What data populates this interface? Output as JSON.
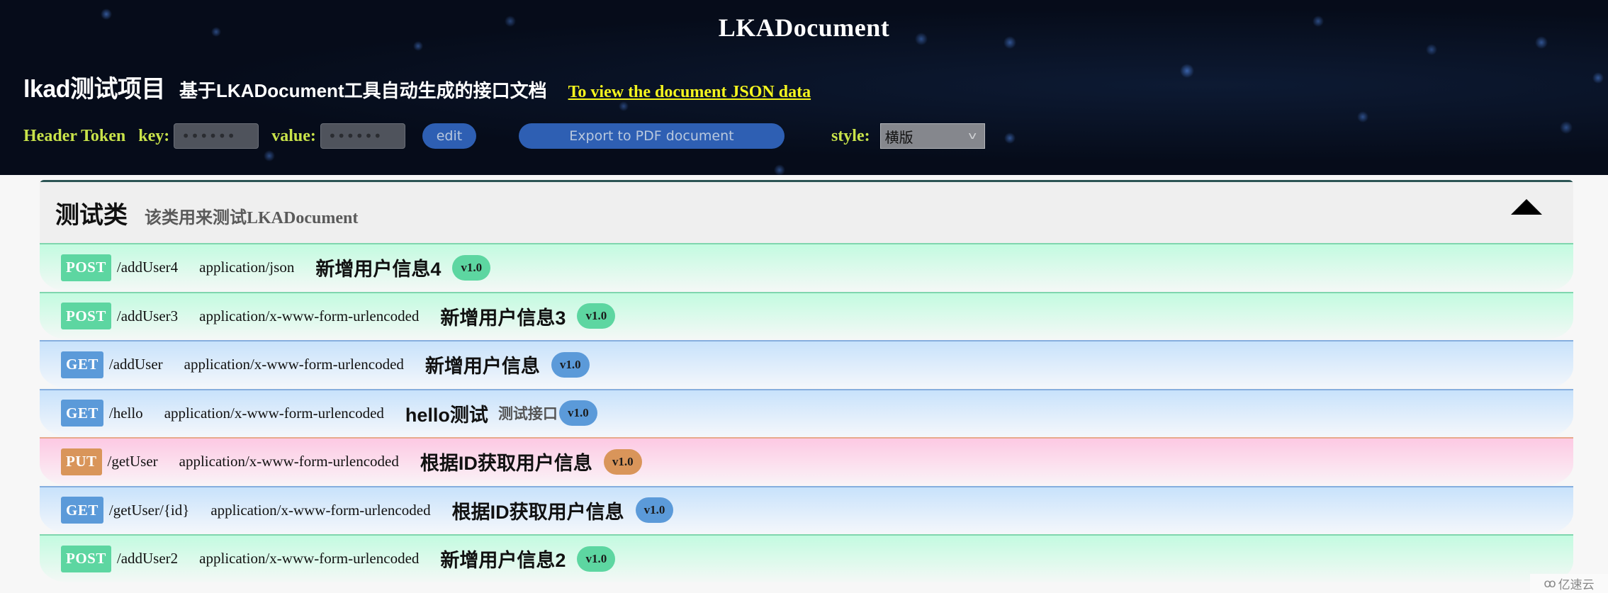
{
  "header": {
    "app_title": "LKADocument",
    "project_name": "lkad测试项目",
    "project_description": "基于LKADocument工具自动生成的接口文档",
    "json_link_label": "To view the document JSON data",
    "token": {
      "label": "Header Token",
      "key_label": "key:",
      "key_value": "••••••",
      "value_label": "value:",
      "value_value": "••••••",
      "edit_label": "edit"
    },
    "export_label": "Export to PDF document",
    "style_label": "style:",
    "style_selected": "横版"
  },
  "section": {
    "class_name": "测试类",
    "class_description": "该类用来测试LKADocument",
    "collapse_icon": "triangle-up-icon",
    "apis": [
      {
        "method": "POST",
        "kind": "post",
        "path": "/addUser4",
        "content_type": "application/json",
        "summary": "新增用户信息4",
        "note": "",
        "version": "v1.0"
      },
      {
        "method": "POST",
        "kind": "post",
        "path": "/addUser3",
        "content_type": "application/x-www-form-urlencoded",
        "summary": "新增用户信息3",
        "note": "",
        "version": "v1.0"
      },
      {
        "method": "GET",
        "kind": "get",
        "path": "/addUser",
        "content_type": "application/x-www-form-urlencoded",
        "summary": "新增用户信息",
        "note": "",
        "version": "v1.0"
      },
      {
        "method": "GET",
        "kind": "get",
        "path": "/hello",
        "content_type": "application/x-www-form-urlencoded",
        "summary": "hello测试",
        "note": "测试接口",
        "version": "v1.0"
      },
      {
        "method": "PUT",
        "kind": "put",
        "path": "/getUser",
        "content_type": "application/x-www-form-urlencoded",
        "summary": "根据ID获取用户信息",
        "note": "",
        "version": "v1.0"
      },
      {
        "method": "GET",
        "kind": "get",
        "path": "/getUser/{id}",
        "content_type": "application/x-www-form-urlencoded",
        "summary": "根据ID获取用户信息",
        "note": "",
        "version": "v1.0"
      },
      {
        "method": "POST",
        "kind": "post",
        "path": "/addUser2",
        "content_type": "application/x-www-form-urlencoded",
        "summary": "新增用户信息2",
        "note": "",
        "version": "v1.0"
      }
    ]
  },
  "colors": {
    "post": "#5dd6a1",
    "get": "#5b9ad9",
    "put": "#d9955a",
    "link": "#f5f51e",
    "toolbar_label": "#c9e34a"
  },
  "watermark": {
    "icon": "cloud-logo-icon",
    "text": "亿速云"
  }
}
